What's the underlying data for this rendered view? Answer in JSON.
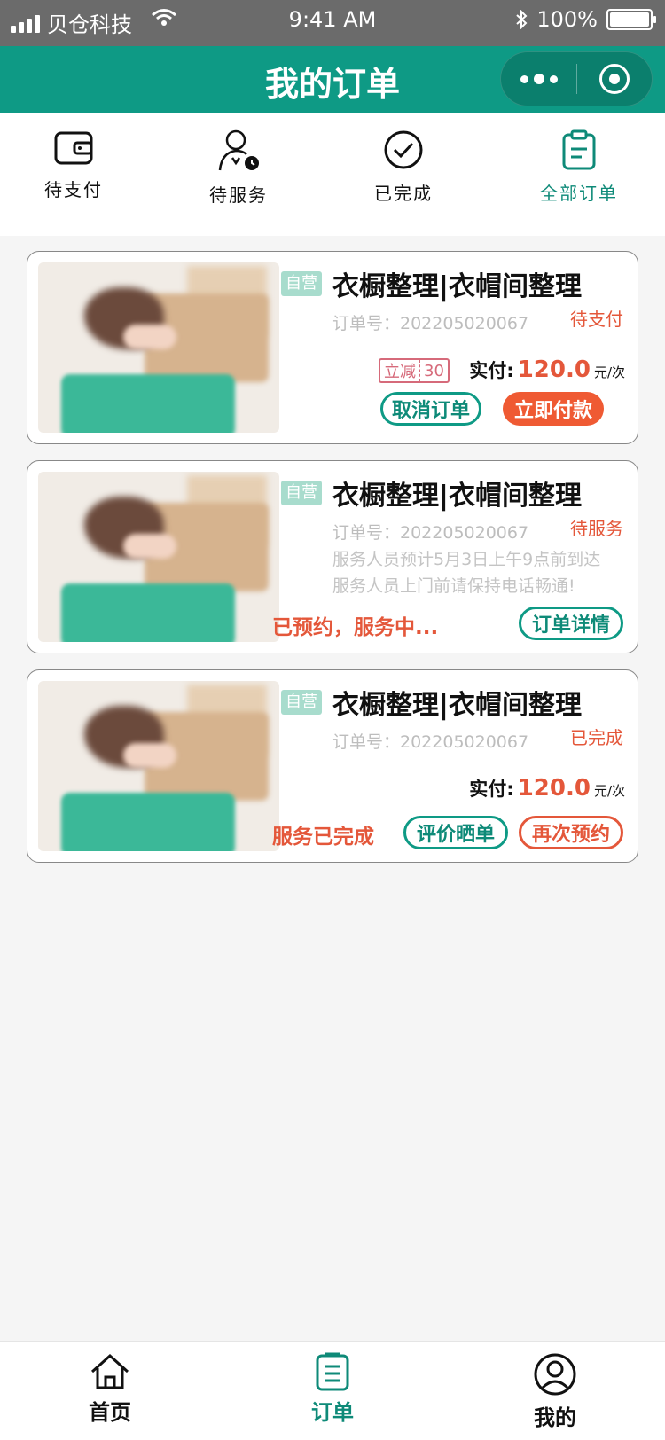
{
  "status_bar": {
    "carrier": "贝仓科技",
    "time": "9:41 AM",
    "battery": "100%"
  },
  "header": {
    "title": "我的订单"
  },
  "tabs": [
    {
      "label": "待支付",
      "icon": "wallet-icon"
    },
    {
      "label": "待服务",
      "icon": "person-clock-icon"
    },
    {
      "label": "已完成",
      "icon": "check-circle-icon"
    },
    {
      "label": "全部订单",
      "icon": "clipboard-icon",
      "active": true
    }
  ],
  "orders": [
    {
      "badge": "自营",
      "title": "衣橱整理|衣帽间整理",
      "order_no": "订单号：202205020067",
      "status": "待支付",
      "discount_label": "立减",
      "discount_value": "30",
      "price_label": "实付:",
      "price": "120.0",
      "unit": "元/次",
      "buttons": [
        "取消订单",
        "立即付款"
      ]
    },
    {
      "badge": "自营",
      "title": "衣橱整理|衣帽间整理",
      "order_no": "订单号：202205020067",
      "status": "待服务",
      "notes": [
        "服务人员预计5月3日上午9点前到达",
        "服务人员上门前请保持电话畅通!"
      ],
      "state_text": "已预约，服务中...",
      "buttons": [
        "订单详情"
      ]
    },
    {
      "badge": "自营",
      "title": "衣橱整理|衣帽间整理",
      "order_no": "订单号：202205020067",
      "status": "已完成",
      "price_label": "实付:",
      "price": "120.0",
      "unit": "元/次",
      "state_text": "服务已完成",
      "buttons": [
        "评价晒单",
        "再次预约"
      ]
    }
  ],
  "bottom_nav": [
    {
      "label": "首页",
      "icon": "home-icon"
    },
    {
      "label": "订单",
      "icon": "order-list-icon",
      "active": true
    },
    {
      "label": "我的",
      "icon": "user-icon"
    }
  ],
  "colors": {
    "primary": "#0e9a85",
    "accent": "#e4573a",
    "status_bar": "#6b6b6b"
  }
}
